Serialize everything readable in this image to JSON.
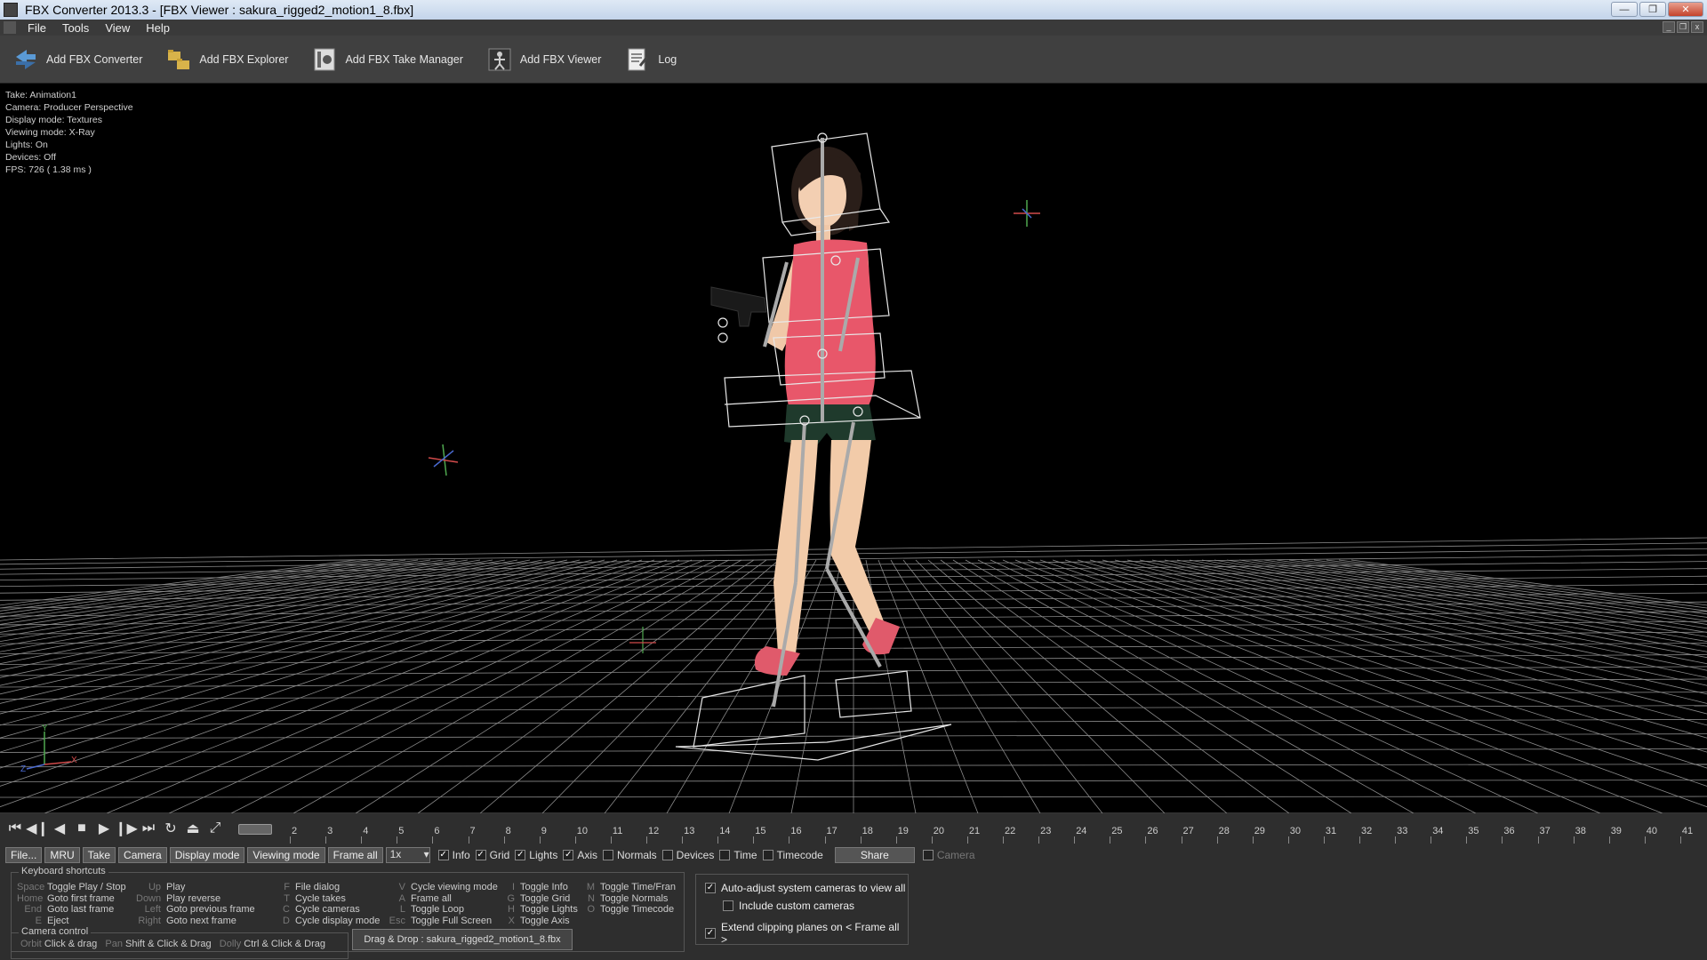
{
  "window": {
    "title": "FBX Converter 2013.3 - [FBX Viewer : sakura_rigged2_motion1_8.fbx]"
  },
  "menu": [
    "File",
    "Tools",
    "View",
    "Help"
  ],
  "toolbar": {
    "items": [
      {
        "label": "Add FBX Converter",
        "icon": "converter-icon"
      },
      {
        "label": "Add FBX Explorer",
        "icon": "explorer-icon"
      },
      {
        "label": "Add FBX Take Manager",
        "icon": "take-manager-icon"
      },
      {
        "label": "Add FBX Viewer",
        "icon": "viewer-icon"
      },
      {
        "label": "Log",
        "icon": "log-icon"
      }
    ]
  },
  "viewport_info": {
    "take": "Take: Animation1",
    "camera": "Camera: Producer Perspective",
    "display_mode": "Display mode: Textures",
    "viewing_mode": "Viewing mode: X-Ray",
    "lights": "Lights: On",
    "devices": "Devices: Off",
    "fps": "FPS: 726 ( 1.38 ms )"
  },
  "timeline": {
    "frames": [
      2,
      3,
      4,
      5,
      6,
      7,
      8,
      9,
      10,
      11,
      12,
      13,
      14,
      15,
      16,
      17,
      18,
      19,
      20,
      21,
      22,
      23,
      24,
      25,
      26,
      27,
      28,
      29,
      30,
      31,
      32,
      33,
      34,
      35,
      36,
      37,
      38,
      39,
      40,
      41
    ],
    "current_frame": 1
  },
  "controls": {
    "file": "File...",
    "mru": "MRU",
    "take": "Take",
    "camera": "Camera",
    "display_mode": "Display mode",
    "viewing_mode": "Viewing mode",
    "frame_all": "Frame all",
    "speed": "1x",
    "checks": [
      {
        "label": "Info",
        "checked": true
      },
      {
        "label": "Grid",
        "checked": true
      },
      {
        "label": "Lights",
        "checked": true
      },
      {
        "label": "Axis",
        "checked": true
      },
      {
        "label": "Normals",
        "checked": false
      },
      {
        "label": "Devices",
        "checked": false
      },
      {
        "label": "Time",
        "checked": false
      },
      {
        "label": "Timecode",
        "checked": false
      }
    ],
    "share": "Share",
    "camera_check": "Camera"
  },
  "shortcuts": {
    "title": "Keyboard shortcuts",
    "col1": [
      {
        "key": "Space",
        "action": "Toggle Play / Stop"
      },
      {
        "key": "Home",
        "action": "Goto first frame"
      },
      {
        "key": "End",
        "action": "Goto last frame"
      },
      {
        "key": "E",
        "action": "Eject"
      }
    ],
    "col2": [
      {
        "key": "Up",
        "action": "Play"
      },
      {
        "key": "Down",
        "action": "Play reverse"
      },
      {
        "key": "Left",
        "action": "Goto previous frame"
      },
      {
        "key": "Right",
        "action": "Goto next frame"
      }
    ],
    "col3": [
      {
        "key": "F",
        "action": "File dialog"
      },
      {
        "key": "T",
        "action": "Cycle takes"
      },
      {
        "key": "C",
        "action": "Cycle cameras"
      },
      {
        "key": "D",
        "action": "Cycle display mode"
      }
    ],
    "col4": [
      {
        "key": "V",
        "action": "Cycle viewing mode"
      },
      {
        "key": "A",
        "action": "Frame all"
      },
      {
        "key": "L",
        "action": "Toggle Loop"
      },
      {
        "key": "Esc",
        "action": "Toggle Full Screen"
      }
    ],
    "col5": [
      {
        "key": "I",
        "action": "Toggle Info"
      },
      {
        "key": "G",
        "action": "Toggle Grid"
      },
      {
        "key": "H",
        "action": "Toggle Lights"
      },
      {
        "key": "X",
        "action": "Toggle Axis"
      }
    ],
    "col6": [
      {
        "key": "M",
        "action": "Toggle Time/Fran"
      },
      {
        "key": "N",
        "action": "Toggle Normals"
      },
      {
        "key": "O",
        "action": "Toggle Timecode"
      }
    ]
  },
  "camera_control": {
    "title": "Camera control",
    "orbit_key": "Orbit",
    "orbit": "Click & drag",
    "pan_key": "Pan",
    "pan": "Shift & Click & Drag",
    "dolly_key": "Dolly",
    "dolly": "Ctrl & Click & Drag"
  },
  "drag_drop": "Drag & Drop : sakura_rigged2_motion1_8.fbx",
  "options": [
    {
      "label": "Auto-adjust system cameras to view all",
      "checked": true
    },
    {
      "label": "Include custom cameras",
      "checked": false
    },
    {
      "label": "Extend clipping planes on < Frame all >",
      "checked": true
    }
  ],
  "colors": {
    "viewport_bg": "#000000",
    "panel_bg": "#2e2e2e",
    "toolbar_bg": "#404040"
  }
}
